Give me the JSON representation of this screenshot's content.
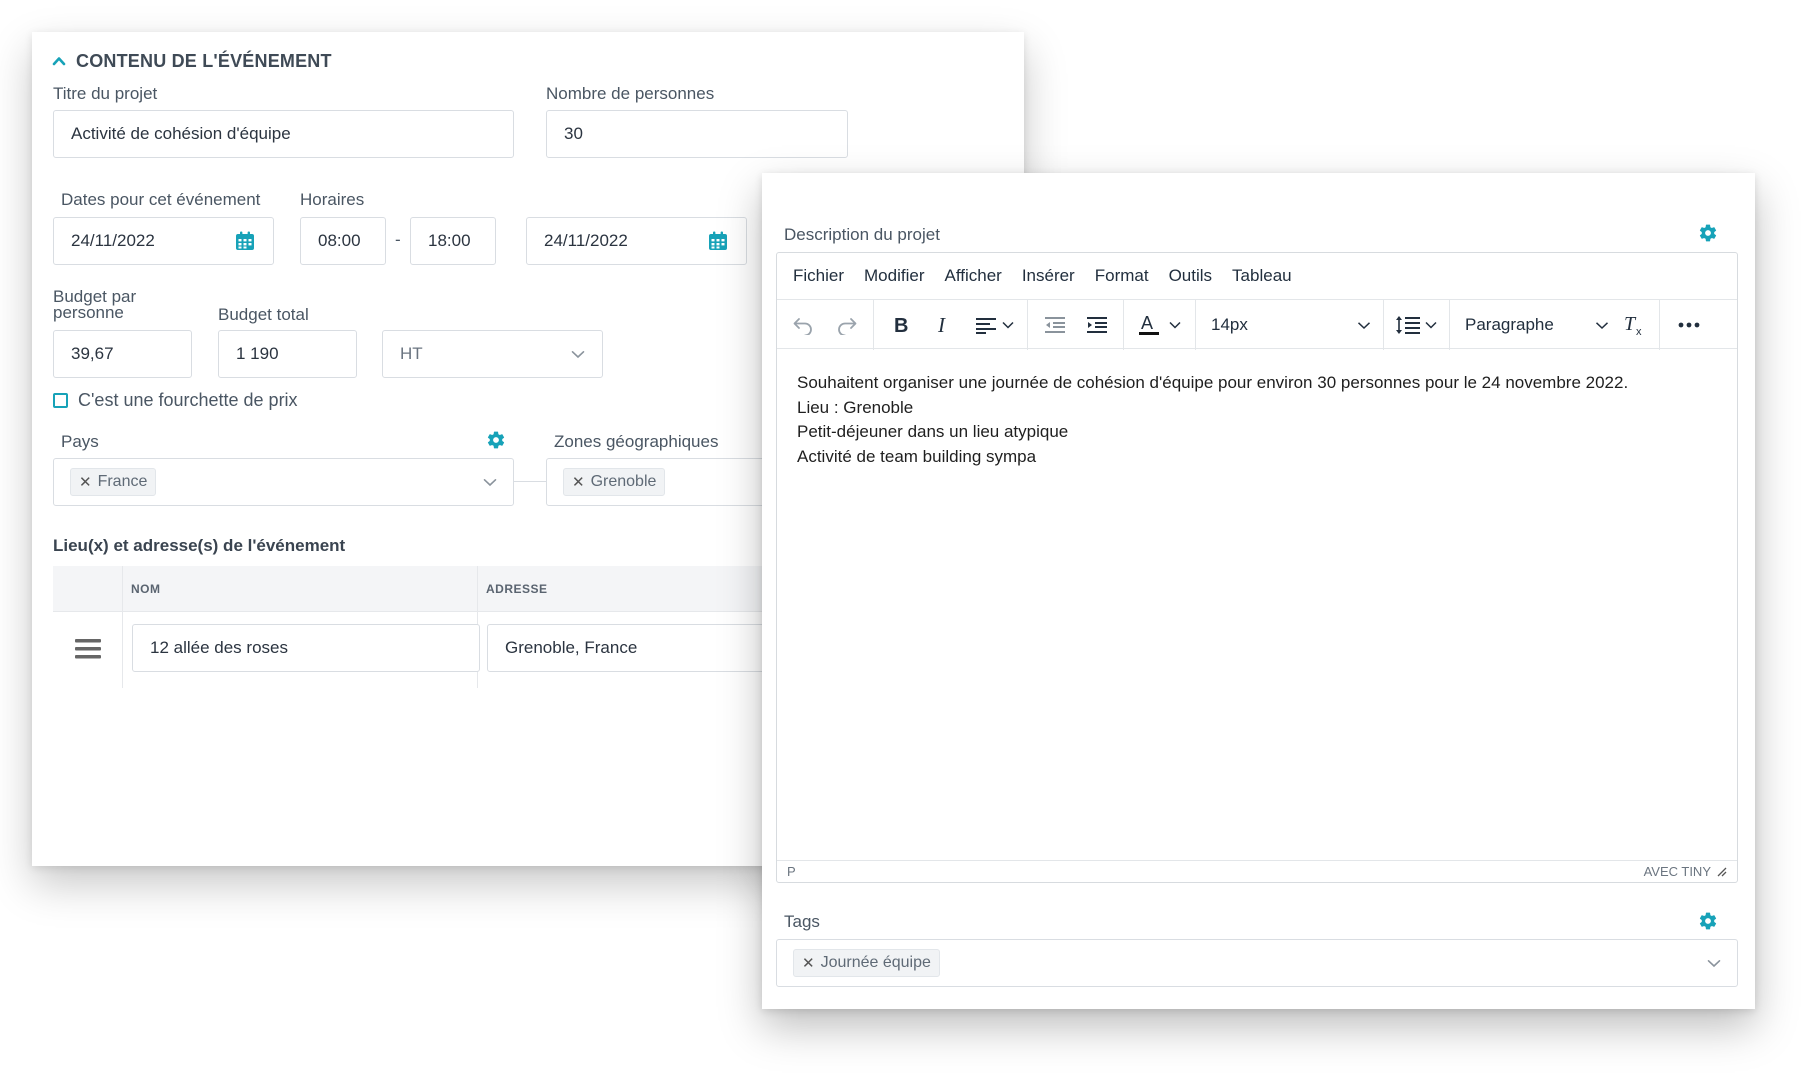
{
  "event": {
    "section_title": "CONTENU DE L'ÉVÉNEMENT",
    "project_title_label": "Titre du projet",
    "project_title_value": "Activité de cohésion d'équipe",
    "people_label": "Nombre de personnes",
    "people_value": "30",
    "dates_label": "Dates pour cet événement",
    "hours_label": "Horaires",
    "start_date": "24/11/2022",
    "start_time": "08:00",
    "time_separator": "-",
    "end_time": "18:00",
    "end_date": "24/11/2022",
    "budget_person_label": "Budget par personne",
    "budget_person_value": "39,67",
    "budget_total_label": "Budget total",
    "budget_total_value": "1 190",
    "tax_mode": "HT",
    "price_range_label": "C'est une fourchette de prix",
    "country_label": "Pays",
    "country_tag": "France",
    "zones_label": "Zones géographiques",
    "zone_tag": "Grenoble",
    "venues_title": "Lieu(x) et adresse(s) de l'événement",
    "table": {
      "col_name": "NOM",
      "col_address": "ADRESSE",
      "rows": [
        {
          "name": "12 allée des roses",
          "address": "Grenoble, France"
        }
      ]
    }
  },
  "description": {
    "label": "Description du projet",
    "menu": [
      "Fichier",
      "Modifier",
      "Afficher",
      "Insérer",
      "Format",
      "Outils",
      "Tableau"
    ],
    "font_size": "14px",
    "block_format": "Paragraphe",
    "content_lines": [
      "Souhaitent organiser une journée de cohésion d'équipe pour environ 30 personnes pour le 24 novembre 2022.",
      "Lieu : Grenoble",
      "Petit-déjeuner dans un lieu atypique",
      "Activité de team building sympa"
    ],
    "status_path": "P",
    "status_brand": "AVEC TINY"
  },
  "tags": {
    "label": "Tags",
    "items": [
      "Journée équipe"
    ]
  },
  "colors": {
    "accent": "#17a2b8",
    "border": "#d9dde2",
    "text": "#2b3440"
  },
  "icons": [
    "chevron-up-icon",
    "calendar-icon",
    "chevron-down-icon",
    "gear-icon",
    "close-icon",
    "drag-handle-icon",
    "undo-icon",
    "redo-icon",
    "bold-icon",
    "italic-icon",
    "align-left-icon",
    "outdent-icon",
    "indent-icon",
    "text-color-icon",
    "line-height-icon",
    "clear-format-icon",
    "more-icon",
    "resize-handle-icon"
  ]
}
